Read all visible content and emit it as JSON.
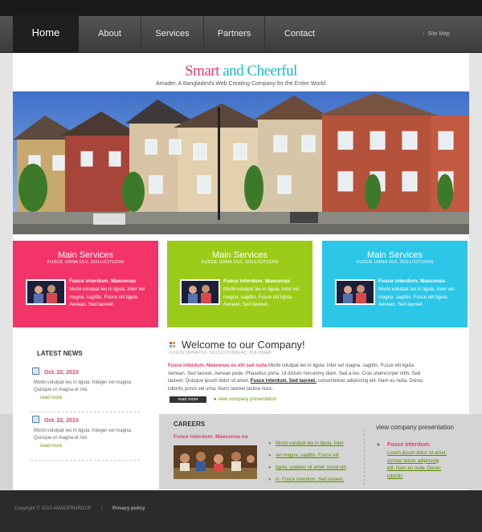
{
  "nav": {
    "items": [
      {
        "label": "Home"
      },
      {
        "label": "About"
      },
      {
        "label": "Services"
      },
      {
        "label": "Partners"
      },
      {
        "label": "Contact"
      }
    ],
    "sitemap_label": "Site Map"
  },
  "header": {
    "slogan_part1": "Smart",
    "slogan_part2": "and",
    "slogan_part3": "Cheerful",
    "tagline": "Amader, A Bangladeshi Web Creating Company for the Entire World."
  },
  "services": [
    {
      "title": "Main Services",
      "subtitle": "FUSCE URNA DUI, SOLLICITUDIN",
      "heading": "Fusce interdum. Maecenas",
      "text": "Morbi volutpat leo in ligula. Inter vel magna. sagittis. Fusce elit ligula. Aenean. Sed laoreet.",
      "color": "#f23468"
    },
    {
      "title": "Main Services",
      "subtitle": "FUSCE URNA DUI, SOLLICITUDIN",
      "heading": "Fusce interdum. Maecenas",
      "text": "Morbi volutpat leo in ligula. Inter vel magna. sagittis. Fusce elit ligula. Aenean. Sed laoreet.",
      "color": "#9ccc1a"
    },
    {
      "title": "Main Services",
      "subtitle": "FUSCE URNA DUI, SOLLICITUDIN",
      "heading": "Fusce interdum. Maecenas",
      "text": "Morbi volutpat leo in ligula. Inter vel magna. sagittis. Fusce elit ligula. Aenean. Sed laoreet.",
      "color": "#2cc6e8"
    }
  ],
  "news": {
    "title": "LATEST NEWS",
    "items": [
      {
        "date": "Oct. 22, 2010",
        "text": "Morbi volutpat leo in ligula. Integer vel magna. Quisque ut magna et nisi",
        "more": "read more"
      },
      {
        "date": "Oct. 22, 2010",
        "text": "Morbi volutpat leo in ligula. Integer vel magna. Quisque ut magna et nisi",
        "more": "read more"
      }
    ]
  },
  "welcome": {
    "title": "Welcome to our Company!",
    "subtitle": "FUSCE URNA DUI, SOLLICITUDIN AC, PULVINAR",
    "highlight": "Fusce interdum. Maecenas eu elit sed nulla",
    "text1": "Morbi volutpat leo in ligula. Inter vel magna. sagittis. Fusce elit ligula. Aenean. Sed laoreet. Aenean pede. Phasellus porta. Ut dictum nonummy diam. Sed a leo. Cras ullamcorper nibh. Sed laoreet. Quisque ipsum dolor sit amet,",
    "underlined": "Fusce interdum. Sed laoreet.",
    "text2": "consectetuer adipiscing elit. Nam eu nulla. Donec lobortis purus vel urna. Nunc laoreet lacinia nunc.",
    "readmore": "read more",
    "link": "view company presentation"
  },
  "careers": {
    "title": "CAREERS",
    "heading": "Fusce interdum. Maecenas eu",
    "links": [
      "Morbi volutpat leo in ligula. Inter",
      "vel magna. sagittis. Fusce elit",
      "ligula. sodales sit amet. tincid unt",
      "in. Fusce interdum. Sed laoreet."
    ]
  },
  "presentation": {
    "title": "view company presentation",
    "heading": "Fusce interdum.",
    "text": "Lorem ipsum dolor sit amet, consec tetuer adipiscing elit. Nam eu nulla. Donec lobortis"
  },
  "footer": {
    "copyright": "Copyright © 2010 AMADERGROUP",
    "separator": "|",
    "privacy": "Privacy policy"
  }
}
